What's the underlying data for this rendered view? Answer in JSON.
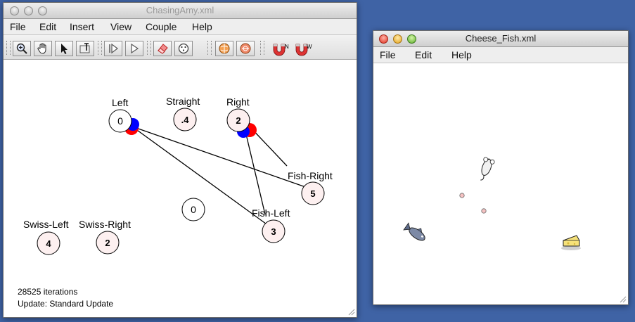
{
  "left_window": {
    "title": "ChasingAmy.xml",
    "menu": [
      "File",
      "Edit",
      "Insert",
      "View",
      "Couple",
      "Help"
    ],
    "toolbar": {
      "buttons": [
        "zoom-icon",
        "hand-icon",
        "arrow-icon",
        "text-tool-icon",
        "step-icon",
        "play-icon",
        "eraser-icon",
        "random-icon",
        "globe-icon",
        "globe-orange-icon",
        "magnet-n-icon",
        "magnet-w-icon"
      ],
      "magnet_n_label": "N",
      "magnet_w_label": "W"
    },
    "network": {
      "nodes": [
        {
          "id": "left",
          "label": "Left",
          "value": "0"
        },
        {
          "id": "straight",
          "label": "Straight",
          "value": ".4"
        },
        {
          "id": "right",
          "label": "Right",
          "value": "2"
        },
        {
          "id": "fish-right",
          "label": "Fish-Right",
          "value": "5"
        },
        {
          "id": "unlabeled",
          "label": "",
          "value": "0"
        },
        {
          "id": "fish-left",
          "label": "Fish-Left",
          "value": "3"
        },
        {
          "id": "swiss-left",
          "label": "Swiss-Left",
          "value": "4"
        },
        {
          "id": "swiss-right",
          "label": "Swiss-Right",
          "value": "2"
        }
      ],
      "connections": [
        {
          "from": "left",
          "to": "fish-right"
        },
        {
          "from": "left",
          "to": "fish-left"
        },
        {
          "from": "right",
          "to": "fish-right"
        },
        {
          "from": "right",
          "to": "fish-left"
        }
      ],
      "colors": {
        "positive_indicator": "#ff0000",
        "negative_indicator": "#0000ff",
        "node_fill": "#fdf0f0"
      }
    },
    "status": {
      "iterations": "28525 iterations",
      "update": "Update: Standard Update"
    }
  },
  "right_window": {
    "title": "Cheese_Fish.xml",
    "menu": [
      "File",
      "Edit",
      "Help"
    ],
    "world": {
      "entities": [
        "mouse-icon",
        "fish-icon",
        "cheese-icon"
      ],
      "marker_color": "#f5c2c2"
    }
  }
}
